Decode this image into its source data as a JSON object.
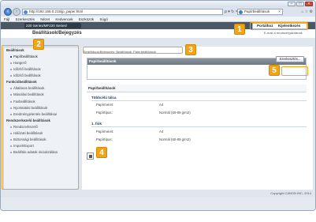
{
  "browser": {
    "url": "http://192.168.0.215/jp_paper.html",
    "url_icons": "ρ ▾ ↻ ×",
    "tab_title": "Papírbeállítások",
    "window_controls": [
      "–",
      "□",
      "×"
    ]
  },
  "menu": [
    "Fájl",
    "Szerkesztés",
    "Nézet",
    "Kedvencek",
    "Eszközök",
    "Súgó"
  ],
  "app": {
    "device_name": "220 Series/MF220 Series/",
    "page_title": "Beállítások/Bejegyzés",
    "top_links": [
      "Portálhoz",
      "Kijelentkezés"
    ],
    "email_link": "E-mail a rendszergazdának"
  },
  "sidebar": {
    "sections": [
      {
        "title": "Beállítások",
        "items": [
          "Papírbeállítások",
          "Hangerő",
          "Időzítő beállítások",
          "Időzítő beállítások"
        ]
      },
      {
        "title": "Funkcióbeállítások",
        "items": [
          "Általános beállítások",
          "Másolási beállítások",
          "Faxbeállítások",
          "Nyomtatási beállítások",
          "Eredményjelentés beállításai"
        ]
      },
      {
        "title": "Rendszerkezelő beállítások",
        "items": [
          "Rendszerkezelő",
          "Hálózati beállítások",
          "Biztonsági beállítások",
          "Import/Export",
          "Beállítás adatok inicializálása"
        ]
      }
    ],
    "active": "Papírbeállítások"
  },
  "main": {
    "breadcrumb": "Beállítások/Bejegyzés: Beállítások: Papírbeállítások",
    "panel_title": "Papírbeállítások",
    "edit_button": "Szerkesztés...",
    "section_title": "Papírbeállítások",
    "sub1_title": "Többcélú tálca",
    "sub1_rows": [
      {
        "label": "Papírméret:",
        "value": "A4"
      },
      {
        "label": "Papírtípus:",
        "value": "Normál (60-89 g/m2)"
      }
    ],
    "sub2_title": "1. fiók",
    "sub2_rows": [
      {
        "label": "Papírméret:",
        "value": "A4"
      },
      {
        "label": "Papírtípus:",
        "value": "Normál (60-89 g/m2)"
      }
    ]
  },
  "footer": "Copyright CANON INC. 2014",
  "callouts": [
    "1",
    "2",
    "3",
    "4",
    "5"
  ],
  "colors": {
    "callout": "#f2a318",
    "header": "#4a5866"
  }
}
